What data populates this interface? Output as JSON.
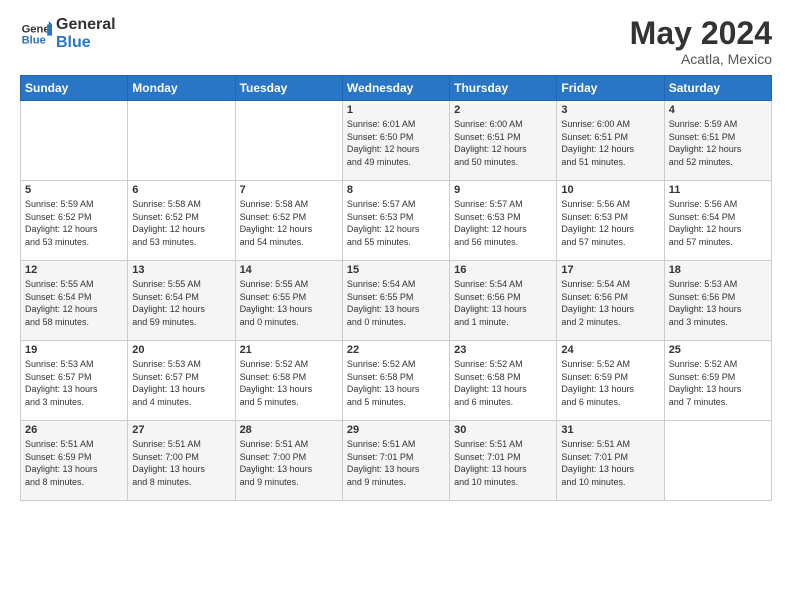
{
  "header": {
    "logo_line1": "General",
    "logo_line2": "Blue",
    "main_title": "May 2024",
    "subtitle": "Acatla, Mexico"
  },
  "days_of_week": [
    "Sunday",
    "Monday",
    "Tuesday",
    "Wednesday",
    "Thursday",
    "Friday",
    "Saturday"
  ],
  "weeks": [
    [
      {
        "day": "",
        "info": ""
      },
      {
        "day": "",
        "info": ""
      },
      {
        "day": "",
        "info": ""
      },
      {
        "day": "1",
        "info": "Sunrise: 6:01 AM\nSunset: 6:50 PM\nDaylight: 12 hours\nand 49 minutes."
      },
      {
        "day": "2",
        "info": "Sunrise: 6:00 AM\nSunset: 6:51 PM\nDaylight: 12 hours\nand 50 minutes."
      },
      {
        "day": "3",
        "info": "Sunrise: 6:00 AM\nSunset: 6:51 PM\nDaylight: 12 hours\nand 51 minutes."
      },
      {
        "day": "4",
        "info": "Sunrise: 5:59 AM\nSunset: 6:51 PM\nDaylight: 12 hours\nand 52 minutes."
      }
    ],
    [
      {
        "day": "5",
        "info": "Sunrise: 5:59 AM\nSunset: 6:52 PM\nDaylight: 12 hours\nand 53 minutes."
      },
      {
        "day": "6",
        "info": "Sunrise: 5:58 AM\nSunset: 6:52 PM\nDaylight: 12 hours\nand 53 minutes."
      },
      {
        "day": "7",
        "info": "Sunrise: 5:58 AM\nSunset: 6:52 PM\nDaylight: 12 hours\nand 54 minutes."
      },
      {
        "day": "8",
        "info": "Sunrise: 5:57 AM\nSunset: 6:53 PM\nDaylight: 12 hours\nand 55 minutes."
      },
      {
        "day": "9",
        "info": "Sunrise: 5:57 AM\nSunset: 6:53 PM\nDaylight: 12 hours\nand 56 minutes."
      },
      {
        "day": "10",
        "info": "Sunrise: 5:56 AM\nSunset: 6:53 PM\nDaylight: 12 hours\nand 57 minutes."
      },
      {
        "day": "11",
        "info": "Sunrise: 5:56 AM\nSunset: 6:54 PM\nDaylight: 12 hours\nand 57 minutes."
      }
    ],
    [
      {
        "day": "12",
        "info": "Sunrise: 5:55 AM\nSunset: 6:54 PM\nDaylight: 12 hours\nand 58 minutes."
      },
      {
        "day": "13",
        "info": "Sunrise: 5:55 AM\nSunset: 6:54 PM\nDaylight: 12 hours\nand 59 minutes."
      },
      {
        "day": "14",
        "info": "Sunrise: 5:55 AM\nSunset: 6:55 PM\nDaylight: 13 hours\nand 0 minutes."
      },
      {
        "day": "15",
        "info": "Sunrise: 5:54 AM\nSunset: 6:55 PM\nDaylight: 13 hours\nand 0 minutes."
      },
      {
        "day": "16",
        "info": "Sunrise: 5:54 AM\nSunset: 6:56 PM\nDaylight: 13 hours\nand 1 minute."
      },
      {
        "day": "17",
        "info": "Sunrise: 5:54 AM\nSunset: 6:56 PM\nDaylight: 13 hours\nand 2 minutes."
      },
      {
        "day": "18",
        "info": "Sunrise: 5:53 AM\nSunset: 6:56 PM\nDaylight: 13 hours\nand 3 minutes."
      }
    ],
    [
      {
        "day": "19",
        "info": "Sunrise: 5:53 AM\nSunset: 6:57 PM\nDaylight: 13 hours\nand 3 minutes."
      },
      {
        "day": "20",
        "info": "Sunrise: 5:53 AM\nSunset: 6:57 PM\nDaylight: 13 hours\nand 4 minutes."
      },
      {
        "day": "21",
        "info": "Sunrise: 5:52 AM\nSunset: 6:58 PM\nDaylight: 13 hours\nand 5 minutes."
      },
      {
        "day": "22",
        "info": "Sunrise: 5:52 AM\nSunset: 6:58 PM\nDaylight: 13 hours\nand 5 minutes."
      },
      {
        "day": "23",
        "info": "Sunrise: 5:52 AM\nSunset: 6:58 PM\nDaylight: 13 hours\nand 6 minutes."
      },
      {
        "day": "24",
        "info": "Sunrise: 5:52 AM\nSunset: 6:59 PM\nDaylight: 13 hours\nand 6 minutes."
      },
      {
        "day": "25",
        "info": "Sunrise: 5:52 AM\nSunset: 6:59 PM\nDaylight: 13 hours\nand 7 minutes."
      }
    ],
    [
      {
        "day": "26",
        "info": "Sunrise: 5:51 AM\nSunset: 6:59 PM\nDaylight: 13 hours\nand 8 minutes."
      },
      {
        "day": "27",
        "info": "Sunrise: 5:51 AM\nSunset: 7:00 PM\nDaylight: 13 hours\nand 8 minutes."
      },
      {
        "day": "28",
        "info": "Sunrise: 5:51 AM\nSunset: 7:00 PM\nDaylight: 13 hours\nand 9 minutes."
      },
      {
        "day": "29",
        "info": "Sunrise: 5:51 AM\nSunset: 7:01 PM\nDaylight: 13 hours\nand 9 minutes."
      },
      {
        "day": "30",
        "info": "Sunrise: 5:51 AM\nSunset: 7:01 PM\nDaylight: 13 hours\nand 10 minutes."
      },
      {
        "day": "31",
        "info": "Sunrise: 5:51 AM\nSunset: 7:01 PM\nDaylight: 13 hours\nand 10 minutes."
      },
      {
        "day": "",
        "info": ""
      }
    ]
  ]
}
